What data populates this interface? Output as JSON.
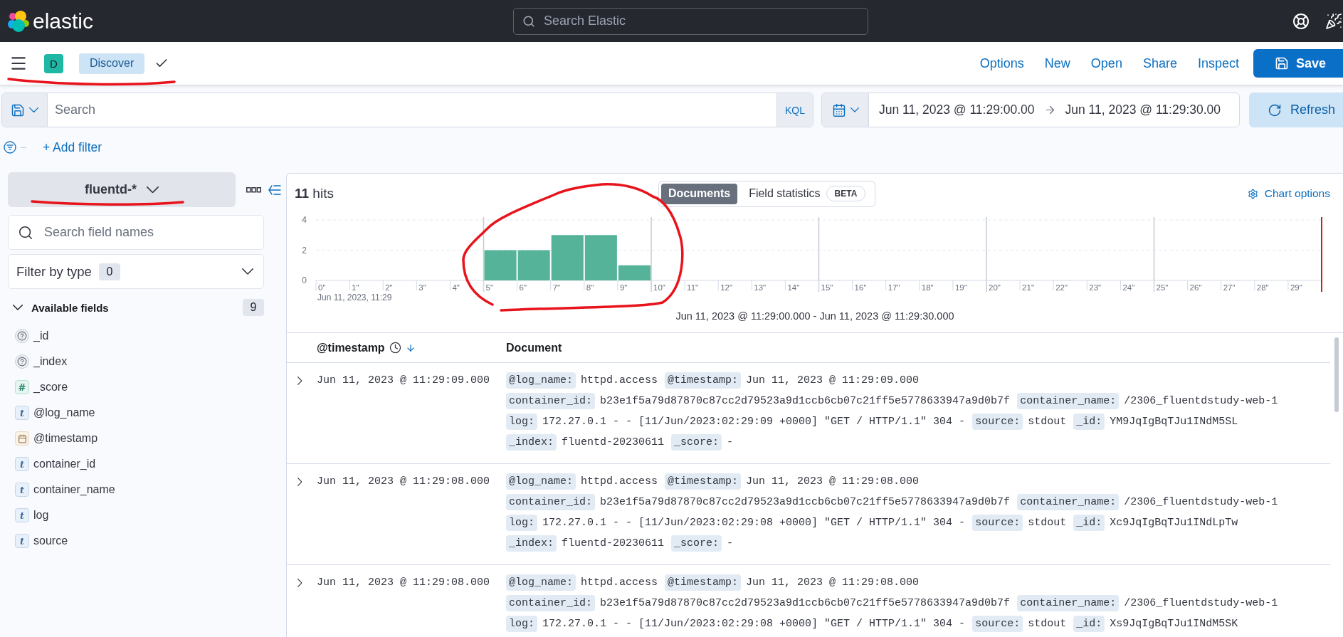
{
  "header": {
    "brand": "elastic",
    "search": {
      "placeholder": "Search Elastic"
    }
  },
  "app_bar": {
    "avatar": "D",
    "breadcrumbs": [
      {
        "label": "Discover"
      }
    ],
    "actions": [
      {
        "label": "Options",
        "kind": "link"
      },
      {
        "label": "New",
        "kind": "link"
      },
      {
        "label": "Open",
        "kind": "link"
      },
      {
        "label": "Share",
        "kind": "link"
      },
      {
        "label": "Inspect",
        "kind": "link"
      },
      {
        "label": "Save",
        "kind": "primary"
      }
    ]
  },
  "query_bar": {
    "search": {
      "placeholder": "Search"
    },
    "language": "KQL"
  },
  "date_picker": {
    "start": "Jun 11, 2023 @ 11:29:00.00",
    "end": "Jun 11, 2023 @ 11:29:30.00",
    "refresh": "Refresh"
  },
  "filter_bar": {
    "add_filter": "+ Add filter"
  },
  "sidebar": {
    "index_pattern": "fluentd-*",
    "search": {
      "placeholder": "Search field names"
    },
    "filter_by_type": {
      "label": "Filter by type",
      "count": "0"
    },
    "available_fields": {
      "label": "Available fields",
      "count": "9",
      "expanded": true,
      "items": [
        {
          "name": "_id",
          "kind": "unknown"
        },
        {
          "name": "_index",
          "kind": "unknown"
        },
        {
          "name": "_score",
          "kind": "number",
          "token": "#"
        },
        {
          "name": "@log_name",
          "kind": "string",
          "token": "t"
        },
        {
          "name": "@timestamp",
          "kind": "date"
        },
        {
          "name": "container_id",
          "kind": "string",
          "token": "t"
        },
        {
          "name": "container_name",
          "kind": "string",
          "token": "t"
        },
        {
          "name": "log",
          "kind": "string",
          "token": "t"
        },
        {
          "name": "source",
          "kind": "string",
          "token": "t"
        }
      ]
    }
  },
  "results": {
    "hits": "**11** hits",
    "view_tabs": [
      {
        "label": "Documents",
        "selected": true
      },
      {
        "label": "Field statistics",
        "selected": false,
        "badge": "BETA"
      }
    ],
    "chart_options": "Chart options",
    "chart_data": {
      "type": "bar",
      "categories": [
        "0\"",
        "1\"",
        "2\"",
        "3\"",
        "4\"",
        "5\"",
        "6\"",
        "7\"",
        "8\"",
        "9\"",
        "10\"",
        "11\"",
        "12\"",
        "13\"",
        "14\"",
        "15\"",
        "16\"",
        "17\"",
        "18\"",
        "19\"",
        "20\"",
        "21\"",
        "22\"",
        "23\"",
        "24\"",
        "25\"",
        "26\"",
        "27\"",
        "28\"",
        "29\""
      ],
      "values": [
        0,
        0,
        0,
        0,
        0,
        2,
        2,
        3,
        3,
        1,
        0,
        0,
        0,
        0,
        0,
        0,
        0,
        0,
        0,
        0,
        0,
        0,
        0,
        0,
        0,
        0,
        0,
        0,
        0,
        0
      ],
      "ylim": [
        0,
        4
      ],
      "yticks": [
        0,
        2,
        4
      ],
      "xlabel": "Jun 11, 2023 @ 11:29:00.000 - Jun 11, 2023 @ 11:29:30.000",
      "annotations": [
        {
          "text": "Jun 11, 2023, 11:29"
        }
      ]
    }
  },
  "table": {
    "columns": [
      {
        "label": "@timestamp",
        "kind": "time"
      },
      {
        "label": "Document",
        "kind": "text"
      }
    ],
    "rows": [
      {
        "expanded": false,
        "timestamp": "Jun 11, 2023 @ 11:29:09.000",
        "document": [
          [
            {
              "key": "@log_name:",
              "value": "httpd.access"
            },
            {
              "key": "@timestamp:",
              "value": "Jun 11, 2023 @ 11:29:09.000"
            }
          ],
          [
            {
              "key": "container_id:",
              "value": "b23e1f5a79d87870c87cc2d79523a9d1ccb6cb07c21ff5e5778633947a9d0b7f"
            },
            {
              "key": "container_name:",
              "value": "/2306_fluentdstudy-web-1"
            }
          ],
          [
            {
              "key": "log:",
              "value": "172.27.0.1 - - [11/Jun/2023:02:29:09 +0000] \"GET / HTTP/1.1\" 304 -"
            },
            {
              "key": "source:",
              "value": "stdout"
            },
            {
              "key": "_id:",
              "value": "YM9JqIgBqTJu1INdM5SL"
            }
          ],
          [
            {
              "key": "_index:",
              "value": "fluentd-20230611"
            },
            {
              "key": "_score:",
              "value": "-"
            }
          ]
        ]
      },
      {
        "expanded": false,
        "timestamp": "Jun 11, 2023 @ 11:29:08.000",
        "document": [
          [
            {
              "key": "@log_name:",
              "value": "httpd.access"
            },
            {
              "key": "@timestamp:",
              "value": "Jun 11, 2023 @ 11:29:08.000"
            }
          ],
          [
            {
              "key": "container_id:",
              "value": "b23e1f5a79d87870c87cc2d79523a9d1ccb6cb07c21ff5e5778633947a9d0b7f"
            },
            {
              "key": "container_name:",
              "value": "/2306_fluentdstudy-web-1"
            }
          ],
          [
            {
              "key": "log:",
              "value": "172.27.0.1 - - [11/Jun/2023:02:29:08 +0000] \"GET / HTTP/1.1\" 304 -"
            },
            {
              "key": "source:",
              "value": "stdout"
            },
            {
              "key": "_id:",
              "value": "Xc9JqIgBqTJu1INdLpTw"
            }
          ],
          [
            {
              "key": "_index:",
              "value": "fluentd-20230611"
            },
            {
              "key": "_score:",
              "value": "-"
            }
          ]
        ]
      },
      {
        "expanded": false,
        "timestamp": "Jun 11, 2023 @ 11:29:08.000",
        "document": [
          [
            {
              "key": "@log_name:",
              "value": "httpd.access"
            },
            {
              "key": "@timestamp:",
              "value": "Jun 11, 2023 @ 11:29:08.000"
            }
          ],
          [
            {
              "key": "container_id:",
              "value": "b23e1f5a79d87870c87cc2d79523a9d1ccb6cb07c21ff5e5778633947a9d0b7f"
            },
            {
              "key": "container_name:",
              "value": "/2306_fluentdstudy-web-1"
            }
          ],
          [
            {
              "key": "log:",
              "value": "172.27.0.1 - - [11/Jun/2023:02:29:08 +0000] \"GET / HTTP/1.1\" 304 -"
            },
            {
              "key": "source:",
              "value": "stdout"
            },
            {
              "key": "_id:",
              "value": "Xs9JqIgBqTJu1INdM5SK"
            }
          ]
        ]
      }
    ]
  }
}
